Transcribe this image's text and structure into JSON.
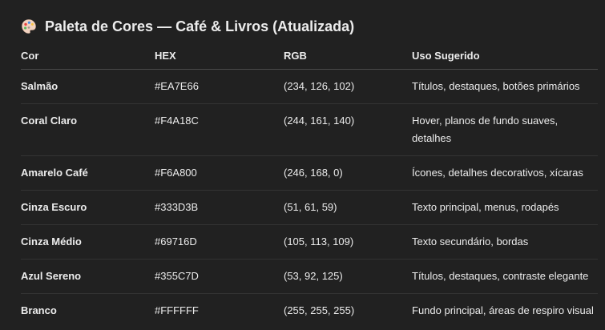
{
  "title": "Paleta de Cores — Café & Livros (Atualizada)",
  "title_icon": "artist-palette-icon",
  "headers": {
    "color": "Cor",
    "hex": "HEX",
    "rgb": "RGB",
    "usage": "Uso Sugerido"
  },
  "rows": [
    {
      "name": "Salmão",
      "hex": "#EA7E66",
      "rgb": "(234, 126, 102)",
      "usage": "Títulos, destaques, botões primários"
    },
    {
      "name": "Coral Claro",
      "hex": "#F4A18C",
      "rgb": "(244, 161, 140)",
      "usage": "Hover, planos de fundo suaves, detalhes"
    },
    {
      "name": "Amarelo Café",
      "hex": "#F6A800",
      "rgb": "(246, 168, 0)",
      "usage": "Ícones, detalhes decorativos, xícaras"
    },
    {
      "name": "Cinza Escuro",
      "hex": "#333D3B",
      "rgb": "(51, 61, 59)",
      "usage": "Texto principal, menus, rodapés"
    },
    {
      "name": "Cinza Médio",
      "hex": "#69716D",
      "rgb": "(105, 113, 109)",
      "usage": "Texto secundário, bordas"
    },
    {
      "name": "Azul Sereno",
      "hex": "#355C7D",
      "rgb": "(53, 92, 125)",
      "usage": "Títulos, destaques, contraste elegante"
    },
    {
      "name": "Branco",
      "hex": "#FFFFFF",
      "rgb": "(255, 255, 255)",
      "usage": "Fundo principal, áreas de respiro visual"
    }
  ]
}
